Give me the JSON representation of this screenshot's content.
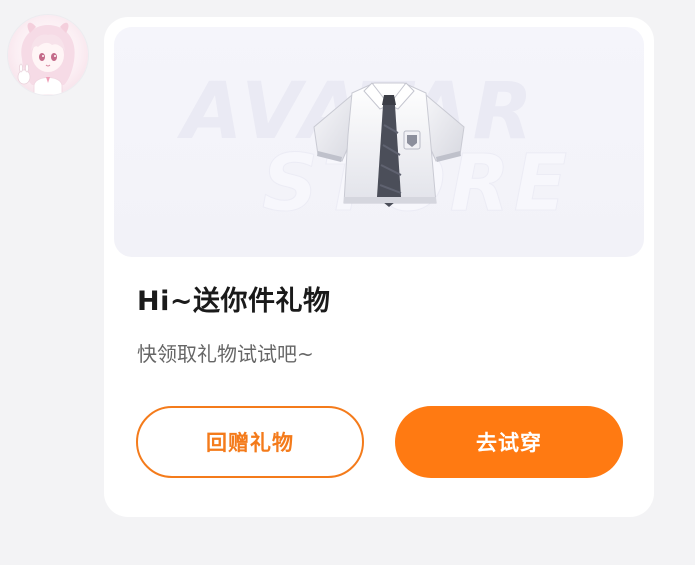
{
  "avatar": {
    "icon": "anime-girl-avatar-icon"
  },
  "card": {
    "banner": {
      "watermark_line1": "AVATAR",
      "watermark_line2": "STORE",
      "item_icon": "school-shirt-with-tie-icon"
    },
    "title": "Hi~送你件礼物",
    "subtitle": "快领取礼物试试吧~",
    "buttons": {
      "return_gift": "回赠礼物",
      "try_on": "去试穿"
    }
  },
  "colors": {
    "accent": "#ff7a12",
    "accent_outline": "#f47b1b",
    "title_text": "#1a1a1a",
    "subtitle_text": "#666666",
    "background": "#f3f3f5",
    "card": "#ffffff"
  }
}
